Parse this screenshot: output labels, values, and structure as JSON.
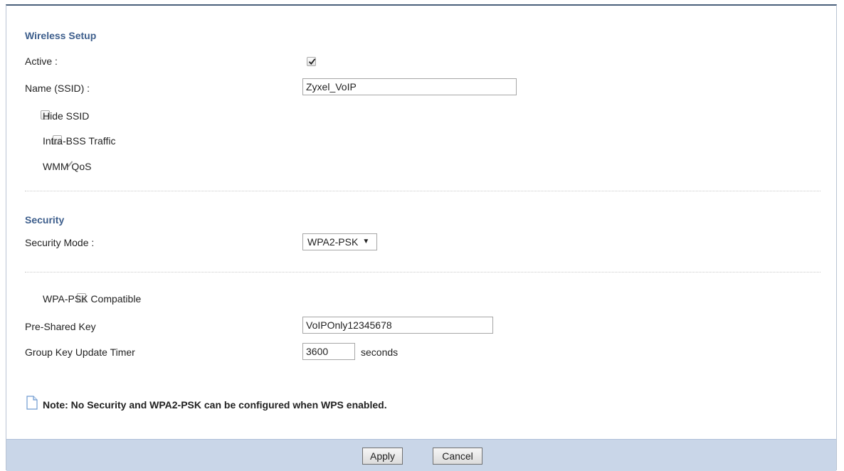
{
  "wireless": {
    "title": "Wireless Setup",
    "active_label": "Active :",
    "active_checked": true,
    "ssid_label": "Name (SSID) :",
    "ssid_value": "Zyxel_VoIP",
    "hide_ssid_label": "Hide SSID",
    "hide_ssid_checked": false,
    "intra_bss_label": "Intra-BSS Traffic",
    "intra_bss_checked": false,
    "wmm_qos_label": "WMM QoS",
    "wmm_qos_checked": true
  },
  "security": {
    "title": "Security",
    "mode_label": "Security Mode :",
    "mode_value": "WPA2-PSK",
    "wpa_psk_compatible_label": "WPA-PSK Compatible",
    "wpa_psk_compatible_checked": false,
    "psk_label": "Pre-Shared Key",
    "psk_value": "VoIPOnly12345678",
    "group_key_label": "Group Key Update Timer",
    "group_key_value": "3600",
    "group_key_unit": "seconds"
  },
  "note": {
    "text": "Note: No Security and WPA2-PSK can be configured when WPS enabled.",
    "icon": "document-icon"
  },
  "footer": {
    "apply_label": "Apply",
    "cancel_label": "Cancel"
  }
}
